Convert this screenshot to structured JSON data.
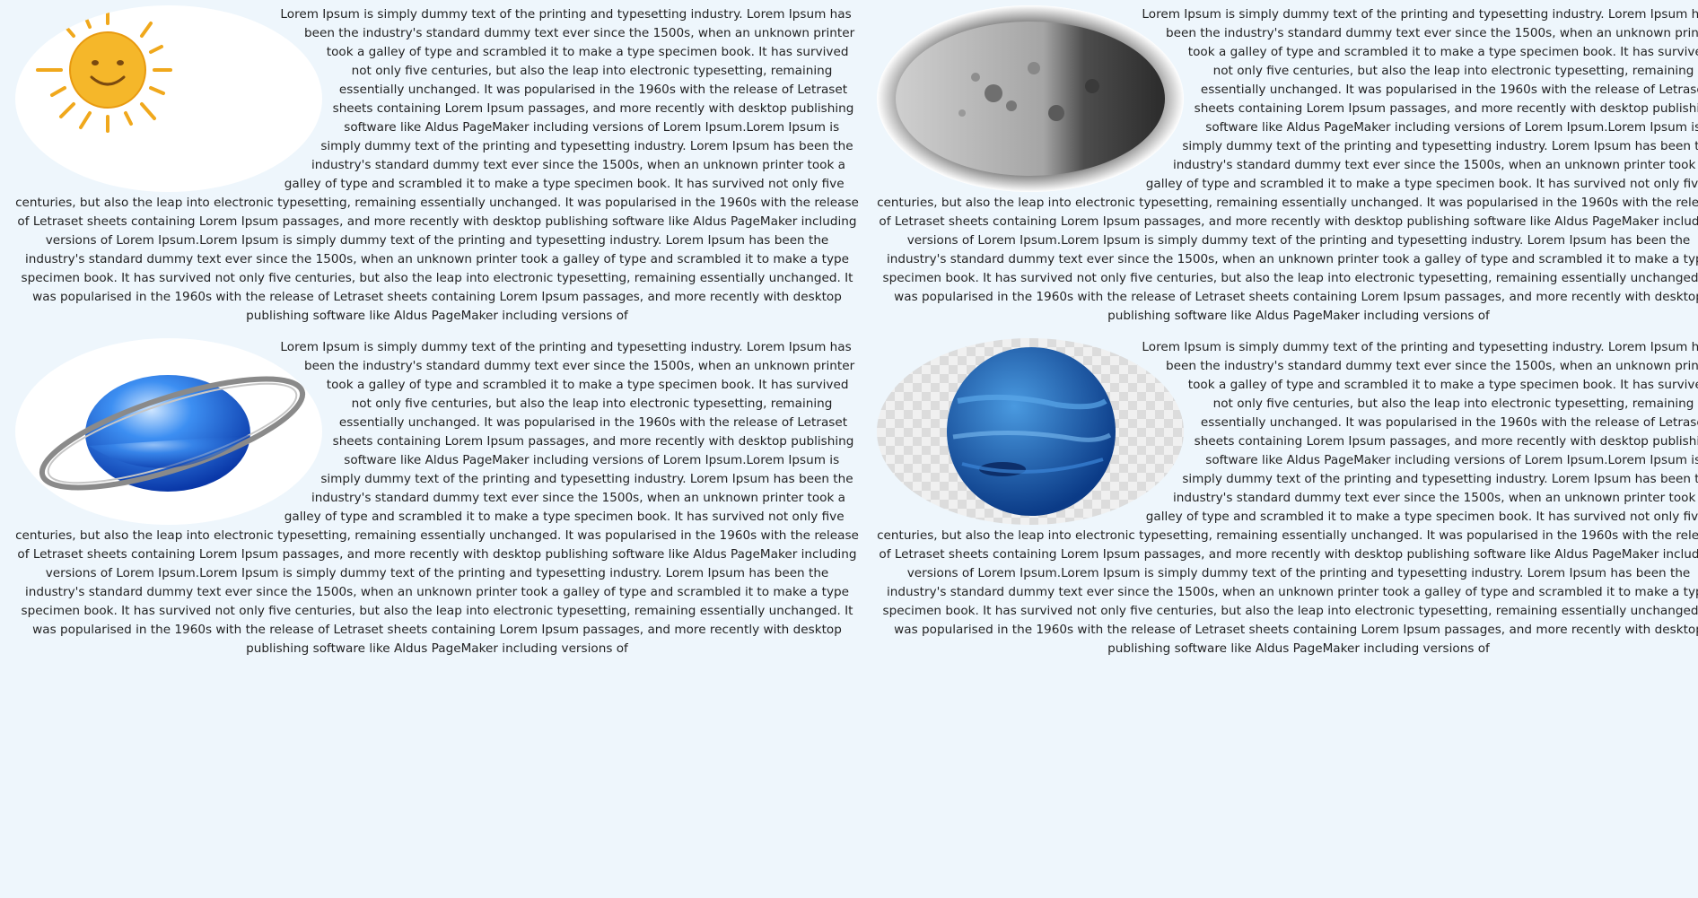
{
  "cards": [
    {
      "name": "sun",
      "image_icon": "sun-icon",
      "paragraph": "Lorem Ipsum is simply dummy text of the printing and typesetting industry. Lorem Ipsum has been the industry's standard dummy text ever since the 1500s, when an unknown printer took a galley of type and scrambled it to make a type specimen book. It has survived not only five centuries, but also the leap into electronic typesetting, remaining essentially unchanged. It was popularised in the 1960s with the release of Letraset sheets containing Lorem Ipsum passages, and more recently with desktop publishing software like Aldus PageMaker including versions of Lorem Ipsum.Lorem Ipsum is simply dummy text of the printing and typesetting industry. Lorem Ipsum has been the industry's standard dummy text ever since the 1500s, when an unknown printer took a galley of type and scrambled it to make a type specimen book. It has survived not only five centuries, but also the leap into electronic typesetting, remaining essentially unchanged. It was popularised in the 1960s with the release of Letraset sheets containing Lorem Ipsum passages, and more recently with desktop publishing software like Aldus PageMaker including versions of Lorem Ipsum.Lorem Ipsum is simply dummy text of the printing and typesetting industry. Lorem Ipsum has been the industry's standard dummy text ever since the 1500s, when an unknown printer took a galley of type and scrambled it to make a type specimen book. It has survived not only five centuries, but also the leap into electronic typesetting, remaining essentially unchanged. It was popularised in the 1960s with the release of Letraset sheets containing Lorem Ipsum passages, and more recently with desktop publishing software like Aldus PageMaker including versions of"
    },
    {
      "name": "moon",
      "image_icon": "moon-icon",
      "paragraph": "Lorem Ipsum is simply dummy text of the printing and typesetting industry. Lorem Ipsum has been the industry's standard dummy text ever since the 1500s, when an unknown printer took a galley of type and scrambled it to make a type specimen book. It has survived not only five centuries, but also the leap into electronic typesetting, remaining essentially unchanged. It was popularised in the 1960s with the release of Letraset sheets containing Lorem Ipsum passages, and more recently with desktop publishing software like Aldus PageMaker including versions of Lorem Ipsum.Lorem Ipsum is simply dummy text of the printing and typesetting industry. Lorem Ipsum has been the industry's standard dummy text ever since the 1500s, when an unknown printer took a galley of type and scrambled it to make a type specimen book. It has survived not only five centuries, but also the leap into electronic typesetting, remaining essentially unchanged. It was popularised in the 1960s with the release of Letraset sheets containing Lorem Ipsum passages, and more recently with desktop publishing software like Aldus PageMaker including versions of Lorem Ipsum.Lorem Ipsum is simply dummy text of the printing and typesetting industry. Lorem Ipsum has been the industry's standard dummy text ever since the 1500s, when an unknown printer took a galley of type and scrambled it to make a type specimen book. It has survived not only five centuries, but also the leap into electronic typesetting, remaining essentially unchanged. It was popularised in the 1960s with the release of Letraset sheets containing Lorem Ipsum passages, and more recently with desktop publishing software like Aldus PageMaker including versions of"
    },
    {
      "name": "saturn",
      "image_icon": "ringed-planet-icon",
      "paragraph": "Lorem Ipsum is simply dummy text of the printing and typesetting industry. Lorem Ipsum has been the industry's standard dummy text ever since the 1500s, when an unknown printer took a galley of type and scrambled it to make a type specimen book. It has survived not only five centuries, but also the leap into electronic typesetting, remaining essentially unchanged. It was popularised in the 1960s with the release of Letraset sheets containing Lorem Ipsum passages, and more recently with desktop publishing software like Aldus PageMaker including versions of Lorem Ipsum.Lorem Ipsum is simply dummy text of the printing and typesetting industry. Lorem Ipsum has been the industry's standard dummy text ever since the 1500s, when an unknown printer took a galley of type and scrambled it to make a type specimen book. It has survived not only five centuries, but also the leap into electronic typesetting, remaining essentially unchanged. It was popularised in the 1960s with the release of Letraset sheets containing Lorem Ipsum passages, and more recently with desktop publishing software like Aldus PageMaker including versions of Lorem Ipsum.Lorem Ipsum is simply dummy text of the printing and typesetting industry. Lorem Ipsum has been the industry's standard dummy text ever since the 1500s, when an unknown printer took a galley of type and scrambled it to make a type specimen book. It has survived not only five centuries, but also the leap into electronic typesetting, remaining essentially unchanged. It was popularised in the 1960s with the release of Letraset sheets containing Lorem Ipsum passages, and more recently with desktop publishing software like Aldus PageMaker including versions of"
    },
    {
      "name": "neptune",
      "image_icon": "blue-planet-icon",
      "paragraph": "Lorem Ipsum is simply dummy text of the printing and typesetting industry. Lorem Ipsum has been the industry's standard dummy text ever since the 1500s, when an unknown printer took a galley of type and scrambled it to make a type specimen book. It has survived not only five centuries, but also the leap into electronic typesetting, remaining essentially unchanged. It was popularised in the 1960s with the release of Letraset sheets containing Lorem Ipsum passages, and more recently with desktop publishing software like Aldus PageMaker including versions of Lorem Ipsum.Lorem Ipsum is simply dummy text of the printing and typesetting industry. Lorem Ipsum has been the industry's standard dummy text ever since the 1500s, when an unknown printer took a galley of type and scrambled it to make a type specimen book. It has survived not only five centuries, but also the leap into electronic typesetting, remaining essentially unchanged. It was popularised in the 1960s with the release of Letraset sheets containing Lorem Ipsum passages, and more recently with desktop publishing software like Aldus PageMaker including versions of Lorem Ipsum.Lorem Ipsum is simply dummy text of the printing and typesetting industry. Lorem Ipsum has been the industry's standard dummy text ever since the 1500s, when an unknown printer took a galley of type and scrambled it to make a type specimen book. It has survived not only five centuries, but also the leap into electronic typesetting, remaining essentially unchanged. It was popularised in the 1960s with the release of Letraset sheets containing Lorem Ipsum passages, and more recently with desktop publishing software like Aldus PageMaker including versions of"
    }
  ],
  "colors": {
    "page_background": "#eef6fc",
    "text": "#222222",
    "sun_fill": "#f5b72a",
    "planet_blue": "#1a5fd0",
    "neptune_blue": "#1f64b8",
    "moon_gray": "#8a8a8a"
  }
}
